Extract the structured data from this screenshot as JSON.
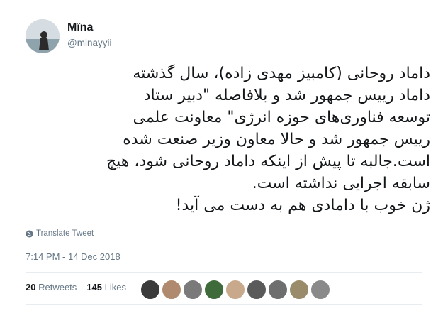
{
  "user": {
    "name": "Mïna",
    "handle": "@minayyii"
  },
  "tweet": {
    "lines": [
      "داماد روحانی (کامبیز مهدی زاده)، سال گذشته",
      "داماد رییس جمهور شد و بلافاصله \"دبیر ستاد",
      "توسعه فناوری‌های حوزه انرژی\" معاونت علمی",
      "رییس جمهور شد و حالا  معاون وزیر صنعت شده",
      "است.جالبه تا پیش از اینکه داماد روحانی شود، هیچ",
      "سابقه  اجرایی نداشته است.",
      "ژن خوب با دامادی هم به دست می آید!"
    ]
  },
  "translate_label": "Translate Tweet",
  "timestamp": "7:14 PM - 14 Dec 2018",
  "stats": {
    "retweets_count": "20",
    "retweets_label": "Retweets",
    "likes_count": "145",
    "likes_label": "Likes"
  },
  "liker_avatars": [
    {
      "color": "#3b3b3b"
    },
    {
      "color": "#b08a6e"
    },
    {
      "color": "#7a7a7a"
    },
    {
      "color": "#3f6b3a"
    },
    {
      "color": "#c9a98c"
    },
    {
      "color": "#5a5a5a"
    },
    {
      "color": "#6e6e6e"
    },
    {
      "color": "#9a8b6a"
    },
    {
      "color": "#8a8a8a"
    }
  ]
}
